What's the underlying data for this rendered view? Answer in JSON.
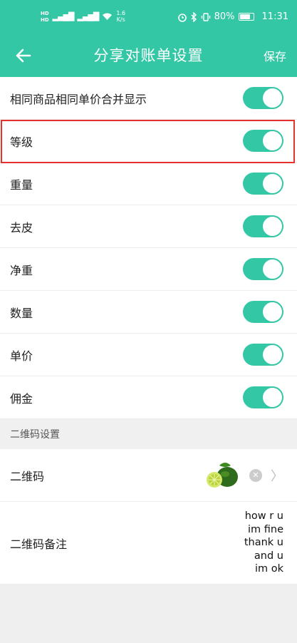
{
  "status_bar": {
    "speed": "1.6\nK/s",
    "battery": "80%",
    "time": "11:31",
    "battery_level": 0.8
  },
  "appbar": {
    "title": "分享对账单设置",
    "save": "保存"
  },
  "settings": [
    {
      "label": "相同商品相同单价合并显示",
      "enabled": true
    },
    {
      "label": "等级",
      "enabled": true
    },
    {
      "label": "重量",
      "enabled": true
    },
    {
      "label": "去皮",
      "enabled": true
    },
    {
      "label": "净重",
      "enabled": true
    },
    {
      "label": "数量",
      "enabled": true
    },
    {
      "label": "单价",
      "enabled": true
    },
    {
      "label": "佣金",
      "enabled": true
    }
  ],
  "qr_section": {
    "header": "二维码设置",
    "qr_label": "二维码",
    "note_label": "二维码备注",
    "note_value": "how r u\nim fine\nthank u\nand u\nim ok"
  },
  "colors": {
    "accent": "#34c7a6",
    "highlight": "#e5322d"
  }
}
